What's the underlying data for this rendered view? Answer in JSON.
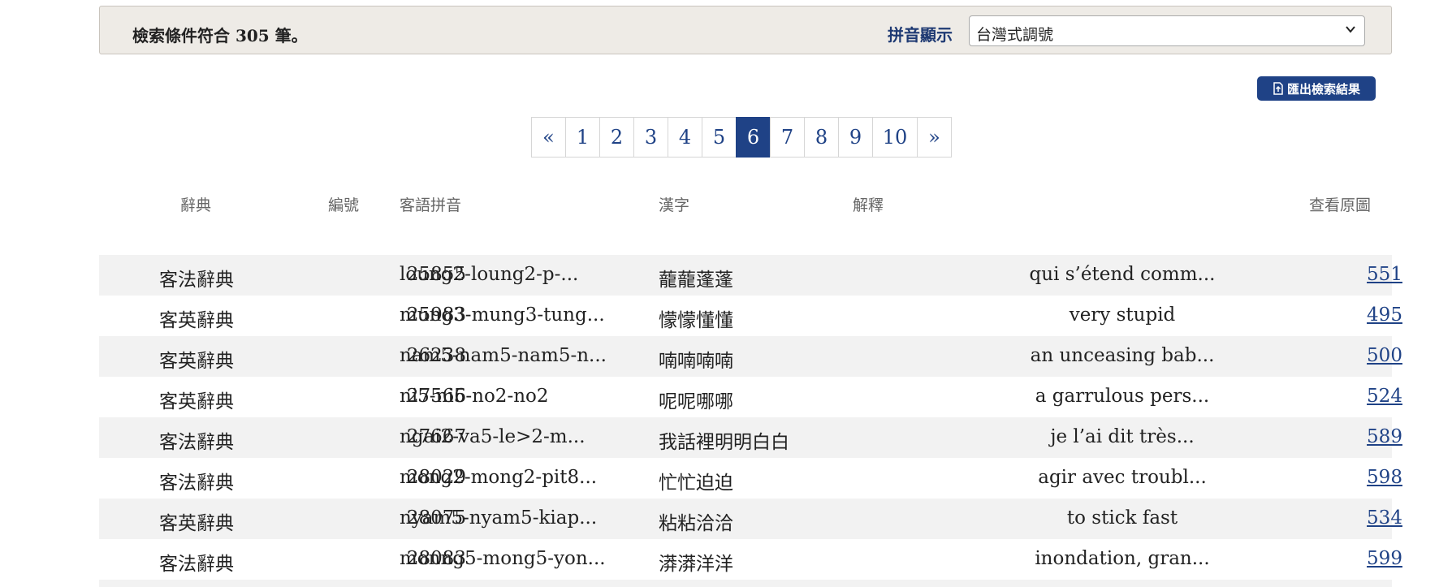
{
  "filter_bar": {
    "result_count": "檢索條件符合 305 筆。",
    "pinyin_label": "拼音顯示",
    "pinyin_select": "台灣式調號"
  },
  "export_button": {
    "label": "匯出檢索結果",
    "icon": "file-export-icon"
  },
  "pagination": {
    "prev": "«",
    "next": "»",
    "pages": [
      "1",
      "2",
      "3",
      "4",
      "5",
      "6",
      "7",
      "8",
      "9",
      "10"
    ],
    "active": "6"
  },
  "table": {
    "headers": {
      "dict": "辭典",
      "id": "編號",
      "pinyin": "客語拼音",
      "hanzi": "漢字",
      "definition": "解釋",
      "original": "查看原圖"
    },
    "rows": [
      {
        "dict": "客法辭典",
        "id": "25855",
        "pinyin": "loung2-loung2-p-...",
        "hanzi": "蘢蘢蓬蓬",
        "definition": "qui s’étend comm...",
        "page": "551"
      },
      {
        "dict": "客英辭典",
        "id": "25983",
        "pinyin": "mung3-mung3-tung...",
        "hanzi": "懞懞懂懂",
        "definition": "very stupid",
        "page": "495"
      },
      {
        "dict": "客英辭典",
        "id": "26238",
        "pinyin": "nam5-nam5-nam5-n...",
        "hanzi": "喃喃喃喃",
        "definition": "an unceasing bab...",
        "page": "500"
      },
      {
        "dict": "客英辭典",
        "id": "27566",
        "pinyin": "ni5-ni5-no2-no2",
        "hanzi": "呢呢哪哪",
        "definition": "a garrulous pers...",
        "page": "524"
      },
      {
        "dict": "客法辭典",
        "id": "27667",
        "pinyin": "ngai2-va5-le>2-m...",
        "hanzi": "我話裡明明白白",
        "definition": "je l’ai dit très...",
        "page": "589"
      },
      {
        "dict": "客法辭典",
        "id": "28029",
        "pinyin": "mong2-mong2-pit8...",
        "hanzi": "忙忙迫迫",
        "definition": "agir avec troubl...",
        "page": "598"
      },
      {
        "dict": "客英辭典",
        "id": "28075",
        "pinyin": "nyam5-nyam5-kiap...",
        "hanzi": "粘粘洽洽",
        "definition": "to stick fast",
        "page": "534"
      },
      {
        "dict": "客法辭典",
        "id": "28083",
        "pinyin": "monng5-mong5-yon...",
        "hanzi": "漭漭洋洋",
        "definition": "inondation, gran...",
        "page": "599"
      }
    ]
  }
}
